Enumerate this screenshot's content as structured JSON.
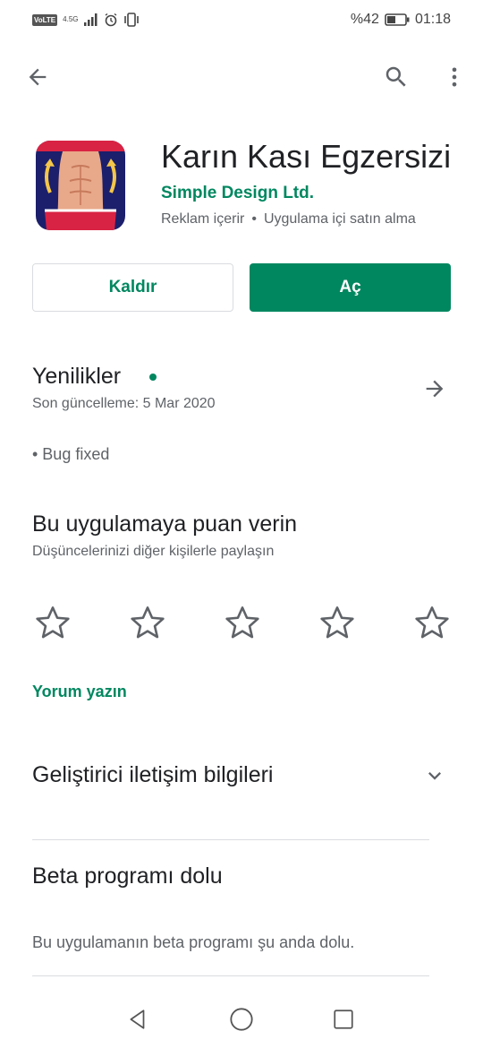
{
  "status_bar": {
    "volte": "VoLTE",
    "network": "4.5G",
    "battery": "%42",
    "time": "01:18"
  },
  "app": {
    "title": "Karın Kası Egzersizi",
    "developer": "Simple Design Ltd.",
    "contains_ads": "Reklam içerir",
    "separator": "•",
    "in_app_purchases": "Uygulama içi satın alma"
  },
  "actions": {
    "uninstall": "Kaldır",
    "open": "Aç"
  },
  "whats_new": {
    "title": "Yenilikler",
    "updated": "Son güncelleme: 5 Mar 2020",
    "notes": "• Bug fixed"
  },
  "rate": {
    "title": "Bu uygulamaya puan verin",
    "subtitle": "Düşüncelerinizi diğer kişilerle paylaşın",
    "stars": 0,
    "write_review": "Yorum yazın"
  },
  "developer_contact": {
    "title": "Geliştirici iletişim bilgileri"
  },
  "beta": {
    "title": "Beta programı dolu",
    "text": "Bu uygulamanın beta programı şu anda dolu."
  },
  "colors": {
    "accent": "#01875f",
    "text": "#202124",
    "secondary": "#5f6368"
  }
}
